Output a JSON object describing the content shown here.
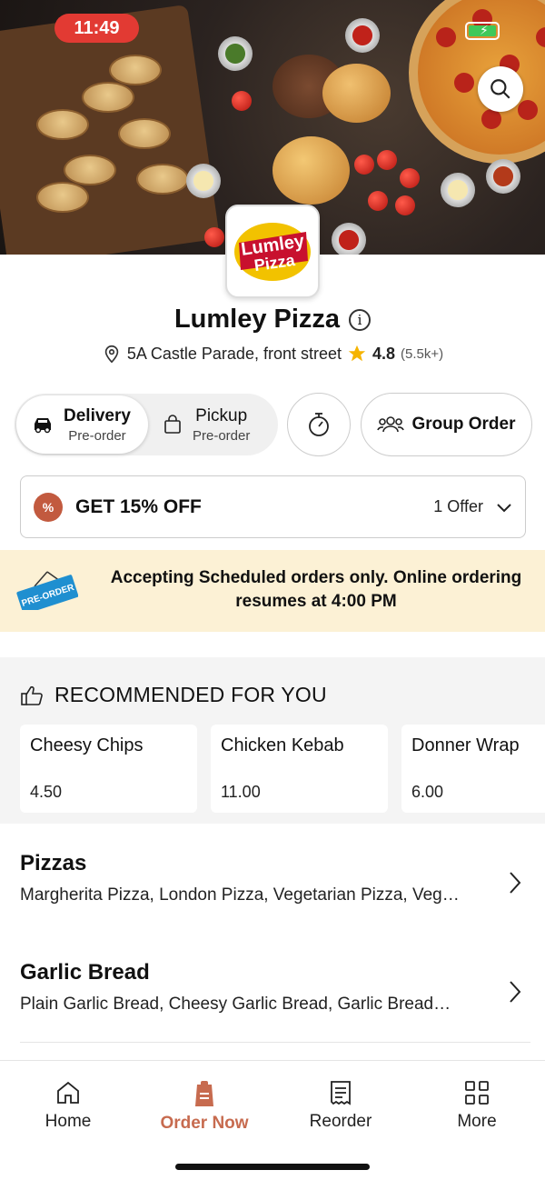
{
  "status_bar": {
    "time": "11:49"
  },
  "restaurant": {
    "name": "Lumley Pizza",
    "address": "5A Castle Parade, front street",
    "rating": "4.8",
    "rating_count": "(5.5k+)",
    "logo_text_line1": "Lumley",
    "logo_text_line2": "Pizza"
  },
  "order_mode": {
    "delivery": {
      "label": "Delivery",
      "sub": "Pre-order",
      "selected": true
    },
    "pickup": {
      "label": "Pickup",
      "sub": "Pre-order",
      "selected": false
    }
  },
  "group_order_label": "Group Order",
  "offer": {
    "badge": "%",
    "title": "GET 15% OFF",
    "count": "1 Offer"
  },
  "banner": {
    "sign": "PRE-ORDER",
    "message": "Accepting Scheduled orders only. Online ordering resumes at 4:00 PM"
  },
  "recommended": {
    "title": "RECOMMENDED FOR YOU",
    "items": [
      {
        "name": "Cheesy Chips",
        "price": "4.50"
      },
      {
        "name": "Chicken Kebab",
        "price": "11.00"
      },
      {
        "name": "Donner Wrap",
        "price": "6.00"
      }
    ]
  },
  "categories": [
    {
      "name": "Pizzas",
      "items": "Margherita Pizza, London Pizza, Vegetarian Pizza, Veg…"
    },
    {
      "name": "Garlic Bread",
      "items": "Plain Garlic Bread, Cheesy Garlic Bread, Garlic Bread…"
    }
  ],
  "bottom_nav": [
    {
      "label": "Home",
      "icon": "home-icon",
      "active": false
    },
    {
      "label": "Order Now",
      "icon": "order-bag-icon",
      "active": true
    },
    {
      "label": "Reorder",
      "icon": "receipt-icon",
      "active": false
    },
    {
      "label": "More",
      "icon": "grid-icon",
      "active": false
    }
  ],
  "colors": {
    "accent": "#c76b4f",
    "status_red": "#e23a33",
    "banner_bg": "#fcf1d5",
    "star": "#f5b400"
  }
}
